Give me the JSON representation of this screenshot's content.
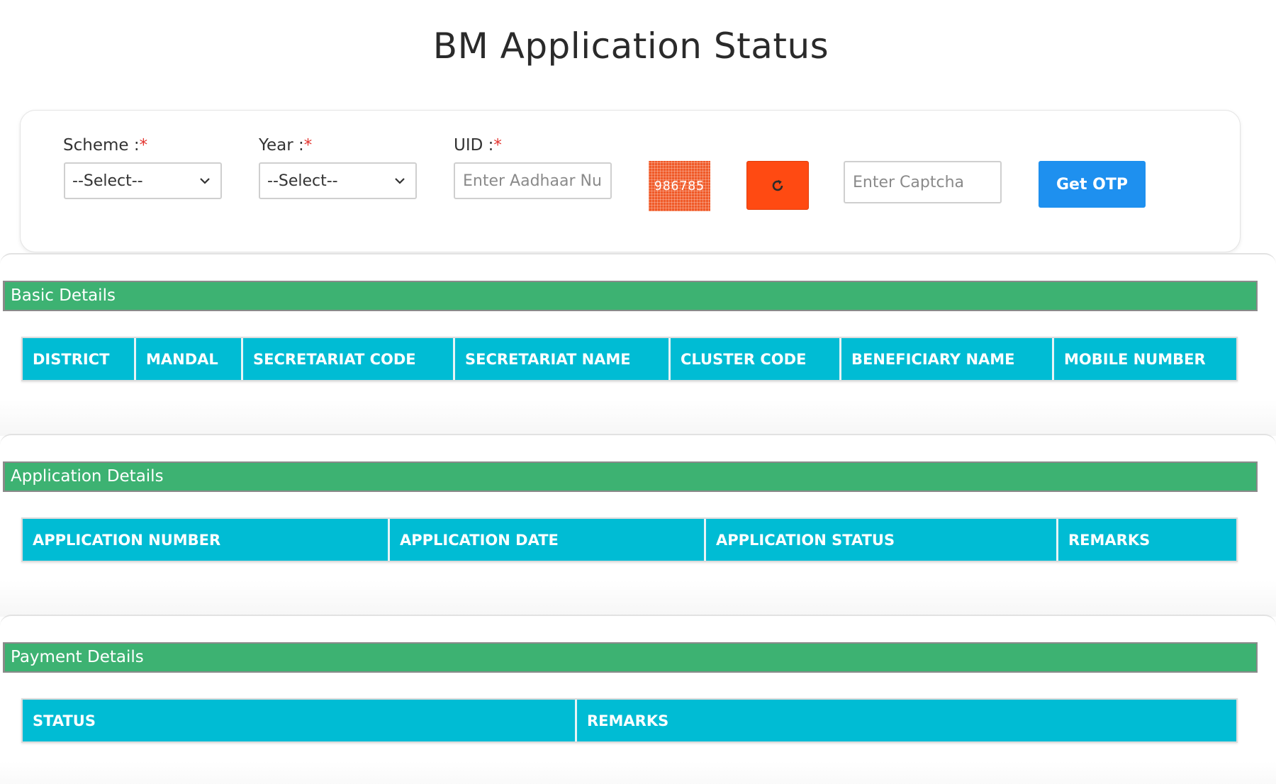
{
  "page": {
    "title": "BM Application Status"
  },
  "form": {
    "scheme": {
      "label": "Scheme :",
      "required_mark": "*",
      "selected": "--Select--"
    },
    "year": {
      "label": "Year :",
      "required_mark": "*",
      "selected": "--Select--"
    },
    "uid": {
      "label": "UID :",
      "required_mark": "*",
      "placeholder": "Enter Aadhaar Number",
      "value": ""
    },
    "captcha": {
      "text": "986785",
      "placeholder": "Enter Captcha",
      "value": ""
    },
    "refresh_icon": "refresh-icon",
    "otp_button": "Get OTP"
  },
  "sections": {
    "basic": {
      "title": "Basic Details",
      "columns": [
        "DISTRICT",
        "MANDAL",
        "SECRETARIAT CODE",
        "SECRETARIAT NAME",
        "CLUSTER CODE",
        "BENEFICIARY NAME",
        "MOBILE NUMBER"
      ]
    },
    "application": {
      "title": "Application Details",
      "columns": [
        "APPLICATION NUMBER",
        "APPLICATION DATE",
        "APPLICATION STATUS",
        "REMARKS"
      ]
    },
    "payment": {
      "title": "Payment Details",
      "columns": [
        "STATUS",
        "REMARKS"
      ]
    }
  },
  "colors": {
    "section_header": "#3db272",
    "table_header": "#00bcd4",
    "refresh_button": "#ff4a12",
    "otp_button": "#1e90ef",
    "required": "#e3342f"
  }
}
